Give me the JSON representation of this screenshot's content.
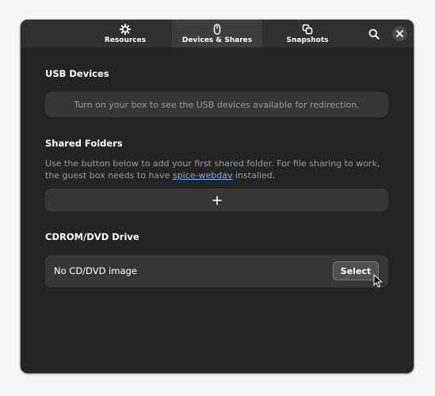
{
  "tabs": [
    {
      "label": "Resources",
      "icon": "gear-icon"
    },
    {
      "label": "Devices & Shares",
      "icon": "mouse-icon"
    },
    {
      "label": "Snapshots",
      "icon": "snapshots-icon"
    }
  ],
  "header": {
    "search_icon": "search-icon",
    "close_icon": "close-icon"
  },
  "usb": {
    "title": "USB Devices",
    "message": "Turn on your box to see the USB devices available for redirection."
  },
  "shared": {
    "title": "Shared Folders",
    "desc_before": "Use the button below to add your first shared folder. For file sharing to work, the guest box needs to have ",
    "link": "spice-webdav",
    "desc_after": " installed.",
    "add_icon": "plus-icon"
  },
  "cdrom": {
    "title": "CDROM/DVD Drive",
    "status": "No CD/DVD image",
    "select_label": "Select"
  },
  "colors": {
    "window_bg": "#242424",
    "header_bg": "#303030",
    "active_tab": "#3d3d3d",
    "row_bg": "#363636",
    "link": "#78aeed"
  }
}
